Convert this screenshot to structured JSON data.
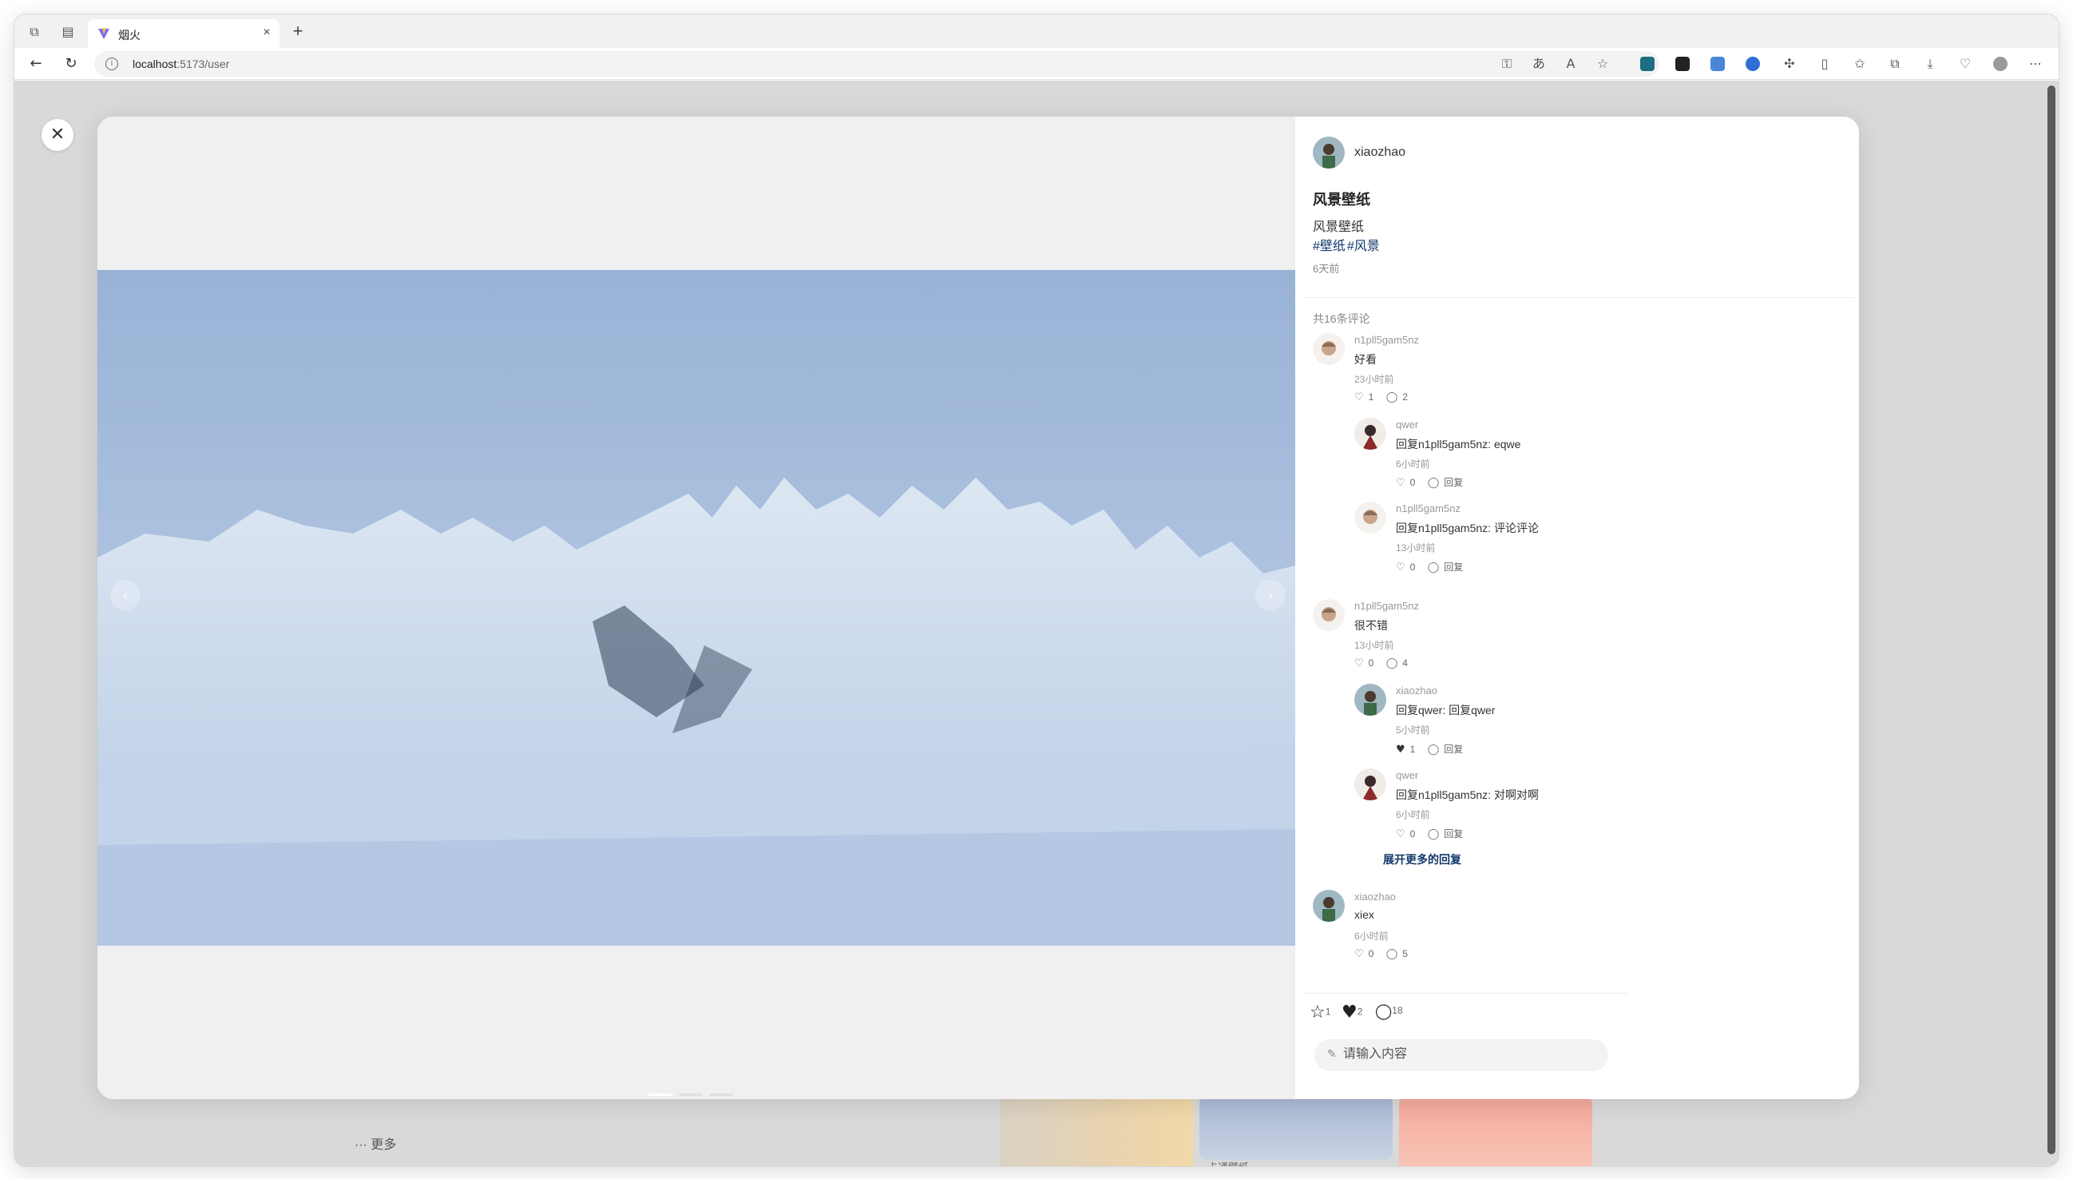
{
  "browser": {
    "tab_title": "烟火",
    "tab_close": "×",
    "new_tab": "+",
    "url_host": "localhost",
    "url_path": ":5173/user"
  },
  "page": {
    "more_label": "··· 更多",
    "thumb_caption": "卡通壁纸"
  },
  "modal": {
    "close": "✕",
    "author": "xiaozhao",
    "title": "风景壁纸",
    "description": "风景壁纸",
    "tags": [
      "#壁纸",
      "#风景"
    ],
    "date": "6天前",
    "comment_count_label": "共16条评论",
    "comments": [
      {
        "name": "n1pll5gam5nz",
        "text": "好看",
        "time": "23小时前",
        "likes": "1",
        "replies": "2",
        "avatar": "boy"
      },
      {
        "name": "qwer",
        "text": "回复n1pll5gam5nz: eqwe",
        "time": "6小时前",
        "likes": "0",
        "replies": "回复",
        "avatar": "girl"
      },
      {
        "name": "n1pll5gam5nz",
        "text": "回复n1pll5gam5nz: 评论评论",
        "time": "13小时前",
        "likes": "0",
        "replies": "回复",
        "avatar": "boy"
      },
      {
        "name": "n1pll5gam5nz",
        "text": "很不错",
        "time": "13小时前",
        "likes": "0",
        "replies": "4",
        "avatar": "boy"
      },
      {
        "name": "xiaozhao",
        "text": "回复qwer: 回复qwer",
        "time": "5小时前",
        "likes": "1",
        "replies": "回复",
        "avatar": "xz"
      },
      {
        "name": "qwer",
        "text": "回复n1pll5gam5nz: 对啊对啊",
        "time": "6小时前",
        "likes": "0",
        "replies": "回复",
        "avatar": "girl"
      },
      {
        "name": "xiaozhao",
        "text": "xiex",
        "time": "6小时前",
        "likes": "0",
        "replies": "5",
        "avatar": "xz"
      }
    ],
    "expand_more": "展开更多的回复",
    "stats": {
      "stars": "1",
      "likes": "2",
      "comments": "18"
    },
    "input_placeholder": "请输入内容"
  },
  "colors": {
    "tag": "#13386c",
    "accent_bg": "#f3f3f3"
  }
}
